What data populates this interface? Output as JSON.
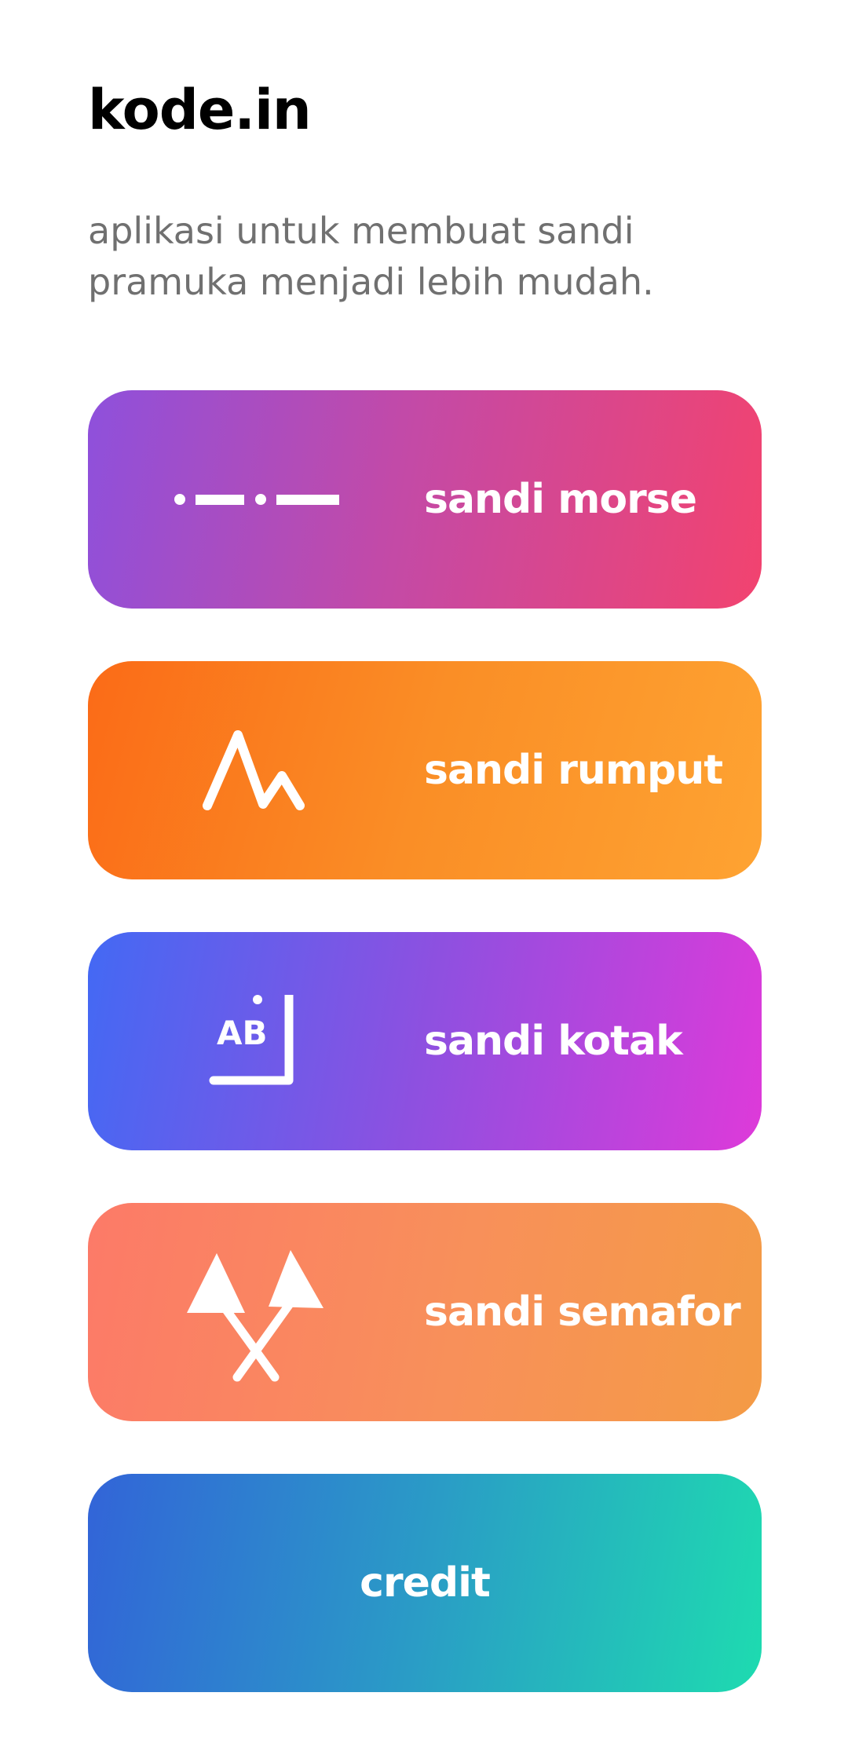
{
  "header": {
    "title": "kode.in",
    "description": "aplikasi untuk membuat sandi pramuka menjadi lebih mudah."
  },
  "menu": {
    "morse": {
      "label": "sandi morse",
      "icon": "morse-code-icon",
      "gradient": [
        "#8e50dc",
        "#f2436f"
      ]
    },
    "rumput": {
      "label": "sandi rumput",
      "icon": "grass-code-icon",
      "gradient": [
        "#fb6b17",
        "#fea332"
      ]
    },
    "kotak": {
      "label": "sandi kotak",
      "icon": "box-code-icon",
      "icon_text": "AB",
      "gradient": [
        "#4369f4",
        "#de3ad9"
      ]
    },
    "semafor": {
      "label": "sandi semafor",
      "icon": "semaphore-flags-icon",
      "gradient": [
        "#fc7a68",
        "#f49b45"
      ]
    },
    "credit": {
      "label": "credit",
      "gradient": [
        "#3264d8",
        "#1edbb0"
      ]
    }
  }
}
